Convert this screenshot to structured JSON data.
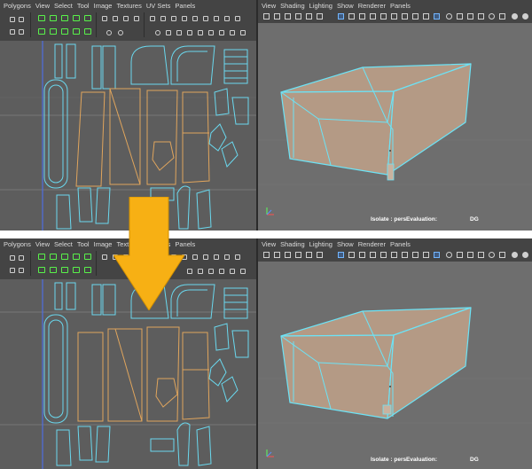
{
  "uv_editor": {
    "menu": [
      "Polygons",
      "View",
      "Select",
      "Tool",
      "Image",
      "Textures",
      "UV Sets",
      "Panels"
    ]
  },
  "viewport": {
    "menu": [
      "View",
      "Shading",
      "Lighting",
      "Show",
      "Renderer",
      "Panels"
    ],
    "hud_isolate": "Isolate : pers",
    "hud_evaluation": "Evaluation:",
    "hud_dg": "DG"
  },
  "colors": {
    "uv_background": "#5d5d5d",
    "viewport_background": "#6e6e6e",
    "uv_shell_orange": "#e0a55d",
    "uv_shell_cyan": "#6ad8ee",
    "mesh_face": "#b49a85",
    "mesh_edge": "#6ce3f6",
    "arrow": "#f7b014",
    "selected_tool": "#59f24a"
  },
  "icons": {
    "arrow": "down-arrow-icon",
    "axis": "axis-gizmo-icon"
  }
}
